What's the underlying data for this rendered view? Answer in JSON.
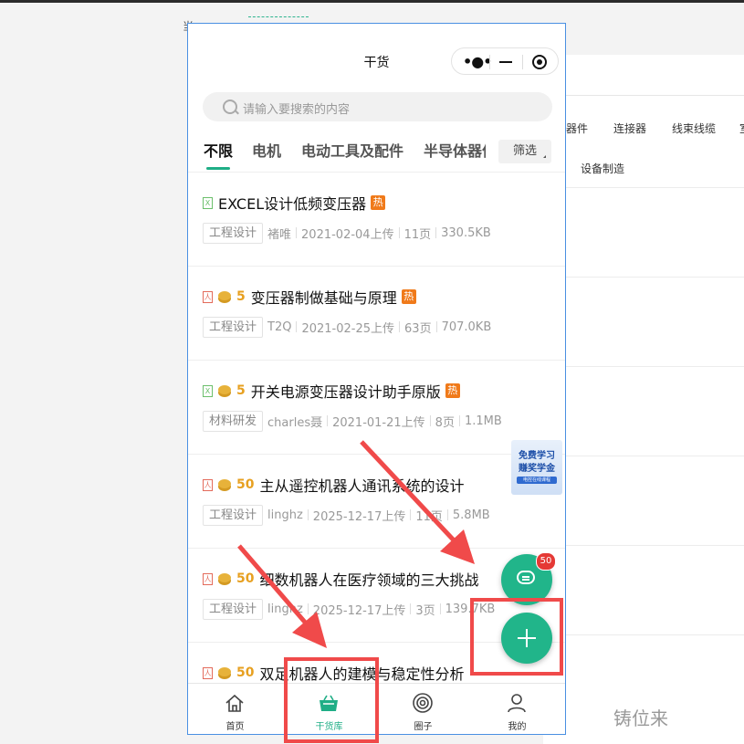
{
  "background": {
    "stub_text": "当",
    "categories": [
      "器件",
      "连接器",
      "线束线缆",
      "室"
    ],
    "subcategory": "设备制造"
  },
  "miniapp": {
    "title": "干货",
    "capsule": {
      "more_icon": "more-dots-icon",
      "minimize_icon": "minimize-icon",
      "close_icon": "target-close-icon"
    },
    "search": {
      "placeholder": "请输入要搜索的内容"
    },
    "tabs": [
      {
        "label": "不限",
        "active": true
      },
      {
        "label": "电机",
        "active": false
      },
      {
        "label": "电动工具及配件",
        "active": false
      },
      {
        "label": "半导体器件",
        "active": false
      }
    ],
    "filter_label": "筛选",
    "items": [
      {
        "file_type": "excel",
        "file_icon": "X",
        "cost": "",
        "title": "EXCEL设计低频变压器",
        "hot": "热",
        "tag": "工程设计",
        "author": "褚唯",
        "date": "2021-02-04上传",
        "pages": "11页",
        "size": "330.5KB"
      },
      {
        "file_type": "pdf",
        "file_icon": "人",
        "cost": "5",
        "title": "变压器制做基础与原理",
        "hot": "热",
        "tag": "工程设计",
        "author": "T2Q",
        "date": "2021-02-25上传",
        "pages": "63页",
        "size": "707.0KB"
      },
      {
        "file_type": "excel",
        "file_icon": "X",
        "cost": "5",
        "title": "开关电源变压器设计助手原版",
        "hot": "热",
        "tag": "材料研发",
        "author": "charles聂",
        "date": "2021-01-21上传",
        "pages": "8页",
        "size": "1.1MB"
      },
      {
        "file_type": "pdf",
        "file_icon": "人",
        "cost": "50",
        "title": "主从遥控机器人通讯系统的设计",
        "hot": "",
        "tag": "工程设计",
        "author": "linghz",
        "date": "2025-12-17上传",
        "pages": "11页",
        "size": "5.8MB"
      },
      {
        "file_type": "pdf",
        "file_icon": "人",
        "cost": "50",
        "title": "细数机器人在医疗领域的三大挑战",
        "hot": "",
        "tag": "工程设计",
        "author": "linghz",
        "date": "2025-12-17上传",
        "pages": "3页",
        "size": "139.7KB"
      },
      {
        "file_type": "pdf",
        "file_icon": "人",
        "cost": "50",
        "title": "双足机器人的建模与稳定性分析",
        "hot": "",
        "tag": "",
        "author": "",
        "date": "",
        "pages": "",
        "size": ""
      }
    ],
    "promo": {
      "line1": "免费学习",
      "line2": "赚奖学金",
      "line3": "电控在线课程"
    },
    "chat_badge": "50",
    "tabbar": [
      {
        "label": "首页",
        "icon": "home-icon",
        "active": false
      },
      {
        "label": "干货库",
        "icon": "basket-icon",
        "active": true
      },
      {
        "label": "圈子",
        "icon": "circle-icon",
        "active": false
      },
      {
        "label": "我的",
        "icon": "user-icon",
        "active": false
      }
    ]
  },
  "watermark": "铸位来",
  "colors": {
    "accent": "#1fae86",
    "hot": "#f07a1a",
    "coin": "#e7b23a",
    "annotation": "#f04a4a"
  }
}
